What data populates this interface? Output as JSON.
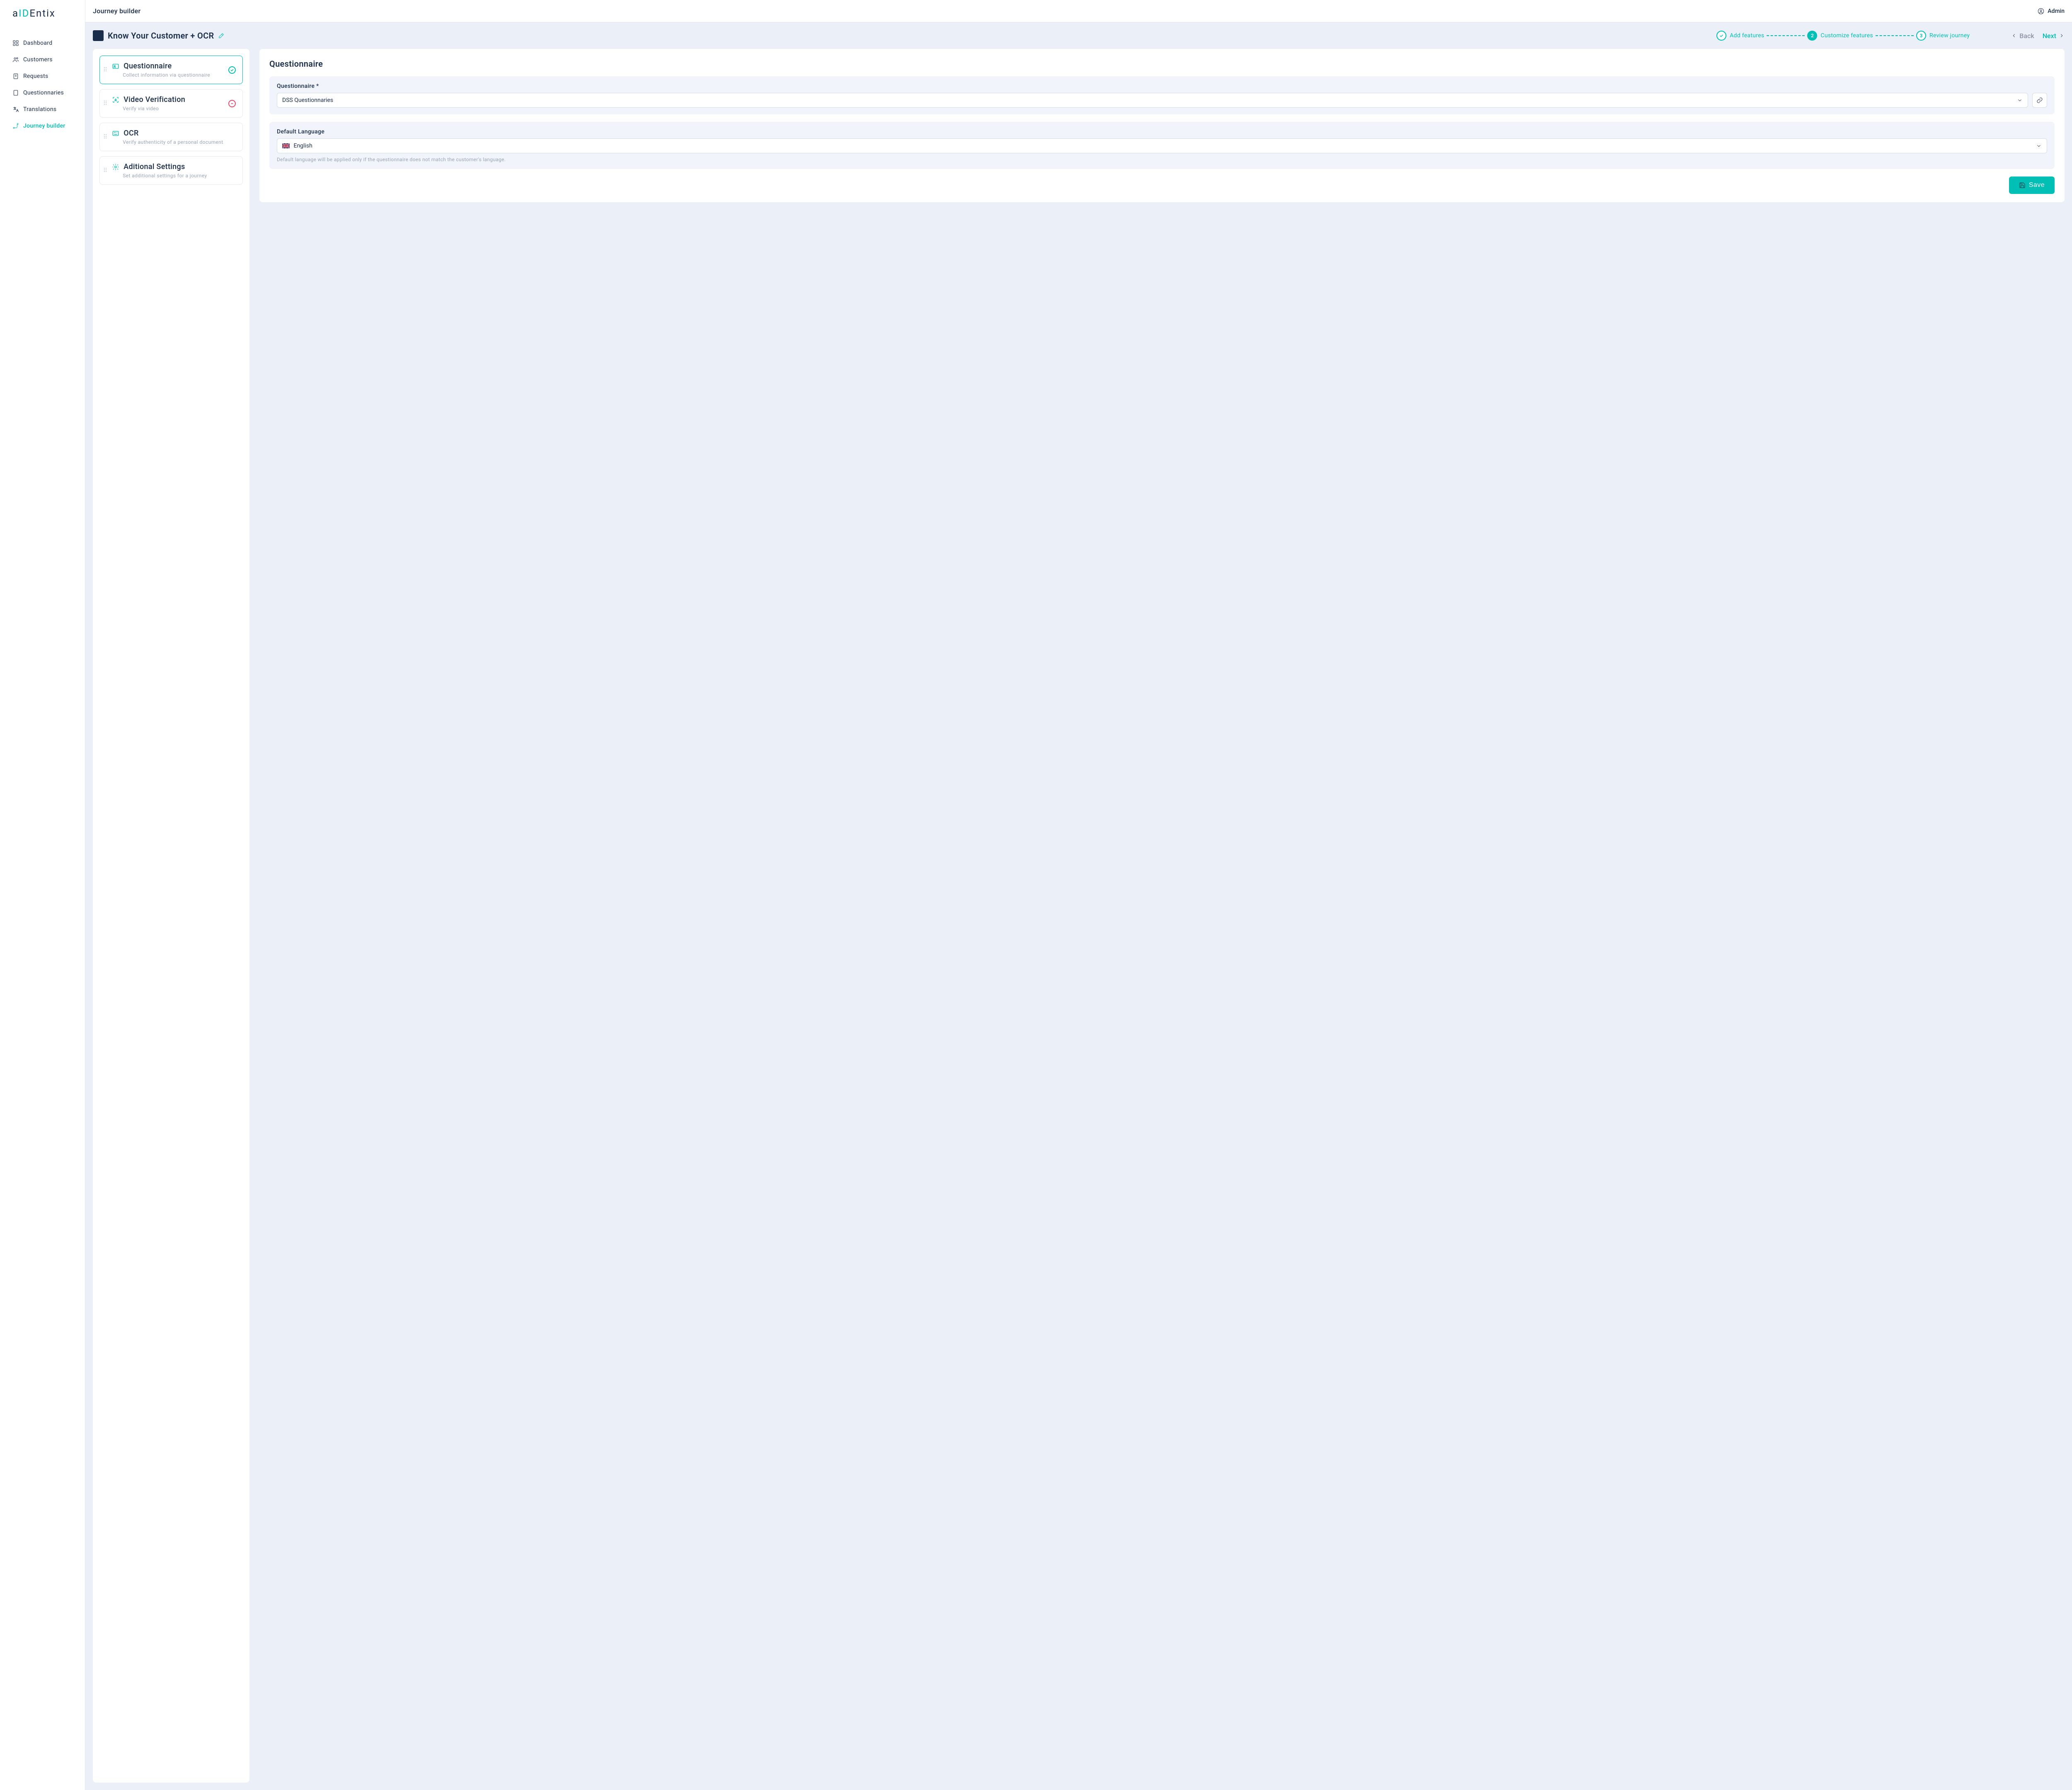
{
  "header": {
    "brand_prefix": "a",
    "brand_mid": "ID",
    "brand_suffix": "Entix",
    "page_title": "Journey builder",
    "user_label": "Admin"
  },
  "sidebar": {
    "items": [
      {
        "label": "Dashboard"
      },
      {
        "label": "Customers"
      },
      {
        "label": "Requests"
      },
      {
        "label": "Questionnaries"
      },
      {
        "label": "Translations"
      },
      {
        "label": "Journey builder"
      }
    ]
  },
  "subheader": {
    "title": "Know Your Customer + OCR",
    "steps": [
      {
        "label": "Add features"
      },
      {
        "label": "Customize features"
      },
      {
        "label": "Review journey"
      }
    ],
    "step3_number": "3",
    "back_label": "Back",
    "next_label": "Next"
  },
  "features": [
    {
      "title": "Questionnaire",
      "desc": "Collect information via questionnaire"
    },
    {
      "title": "Video Verification",
      "desc": "Verify via video"
    },
    {
      "title": "OCR",
      "desc": "Verify authenticity of a personal document"
    },
    {
      "title": "Aditional Settings",
      "desc": "Set additional settings for a journey"
    }
  ],
  "panel": {
    "title": "Questionnaire",
    "questionnaire_label": "Questionnaire *",
    "questionnaire_value": "DSS Questionnaries",
    "lang_label": "Default Language",
    "lang_value": "English",
    "helper_text": "Default language will be applied only if the questionnaire does not match the customer's language.",
    "save_label": "Save"
  }
}
